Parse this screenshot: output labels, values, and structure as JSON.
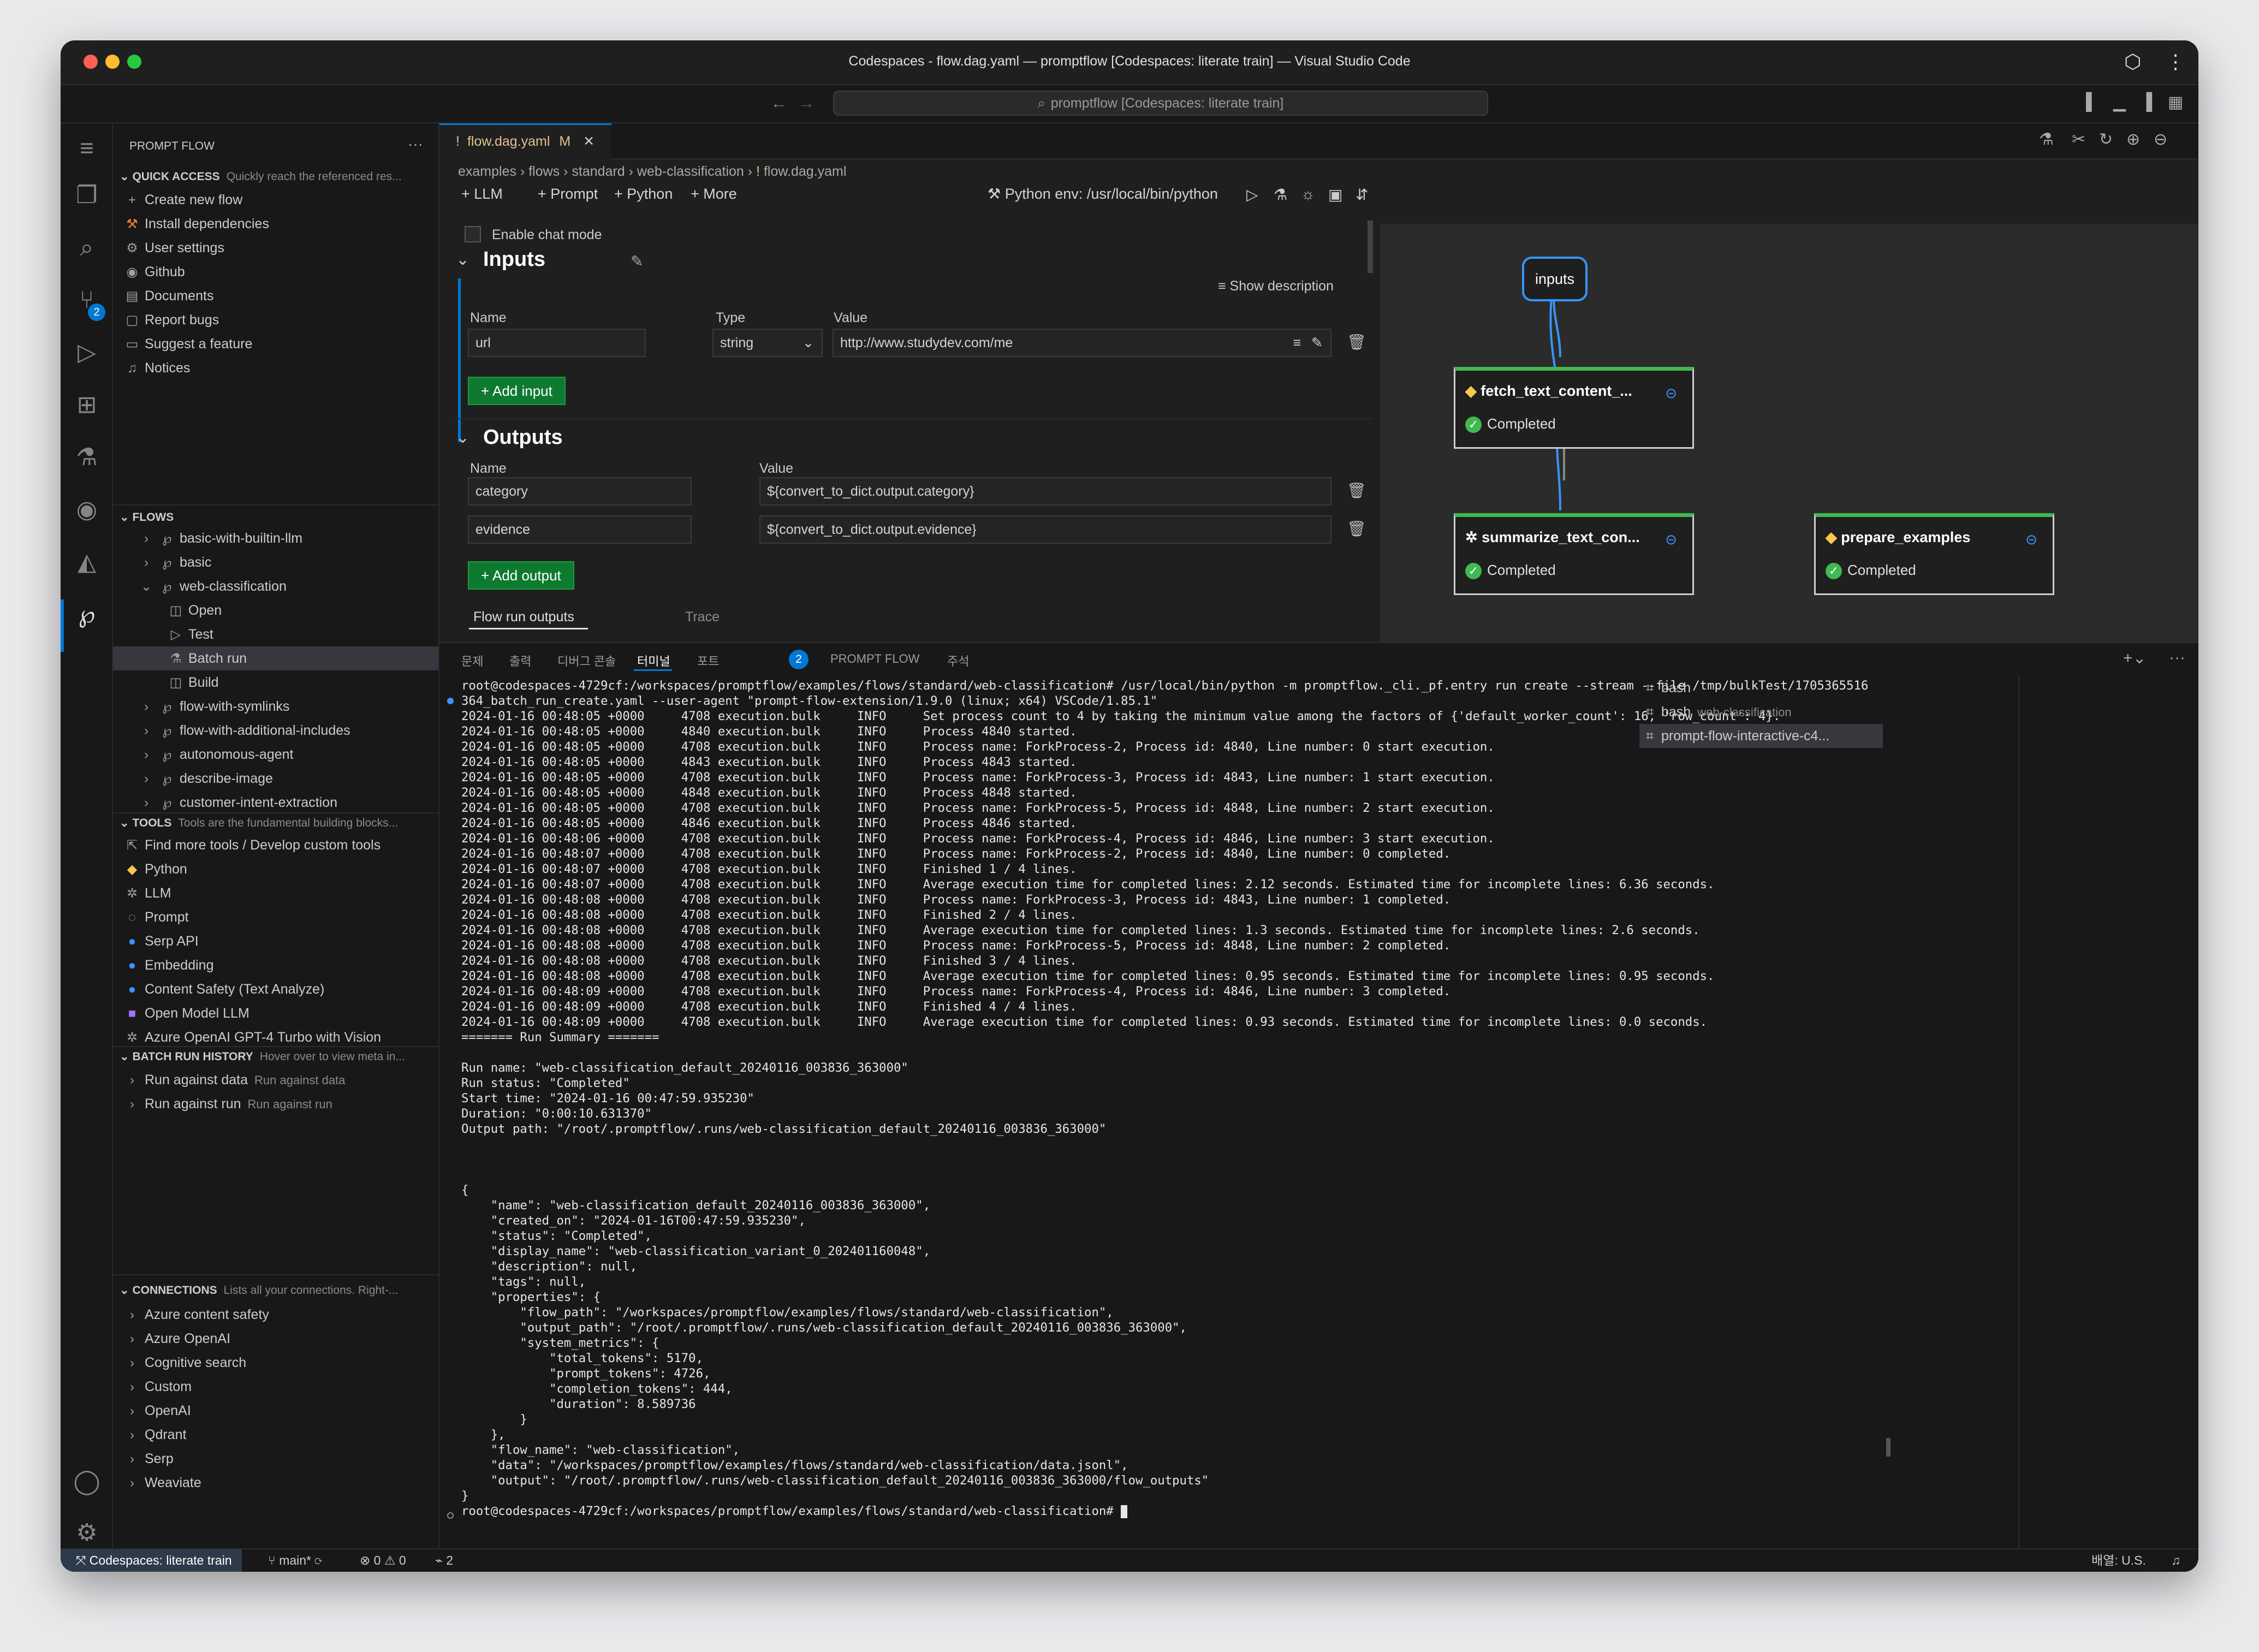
{
  "window": {
    "title": "Codespaces - flow.dag.yaml — promptflow [Codespaces: literate train] — Visual Studio Code",
    "search_label": "promptflow [Codespaces: literate train]"
  },
  "activity_bar": {
    "scm_badge": "2"
  },
  "sidebar": {
    "title": "PROMPT FLOW",
    "quick_access": {
      "title": "QUICK ACCESS",
      "desc": "Quickly reach the referenced res...",
      "items": [
        "Create new flow",
        "Install dependencies",
        "User settings",
        "Github",
        "Documents",
        "Report bugs",
        "Suggest a feature",
        "Notices"
      ]
    },
    "flows": {
      "title": "FLOWS",
      "items": [
        "basic-with-builtin-llm",
        "basic",
        "web-classification",
        "Open",
        "Test",
        "Batch run",
        "Build",
        "flow-with-symlinks",
        "flow-with-additional-includes",
        "autonomous-agent",
        "describe-image",
        "customer-intent-extraction"
      ]
    },
    "tools": {
      "title": "TOOLS",
      "desc": "Tools are the fundamental building blocks...",
      "items": [
        "Find more tools / Develop custom tools",
        "Python",
        "LLM",
        "Prompt",
        "Serp API",
        "Embedding",
        "Content Safety (Text Analyze)",
        "Open Model LLM",
        "Azure OpenAI GPT-4 Turbo with Vision"
      ]
    },
    "batch_history": {
      "title": "BATCH RUN HISTORY",
      "desc": "Hover over to view meta in...",
      "items": [
        {
          "label": "Run against data",
          "desc": "Run against data"
        },
        {
          "label": "Run against run",
          "desc": "Run against run"
        }
      ]
    },
    "connections": {
      "title": "CONNECTIONS",
      "desc": "Lists all your connections. Right-...",
      "items": [
        "Azure content safety",
        "Azure OpenAI",
        "Cognitive search",
        "Custom",
        "OpenAI",
        "Qdrant",
        "Serp",
        "Weaviate"
      ]
    }
  },
  "editor": {
    "tab": {
      "label": "flow.dag.yaml",
      "status": "M",
      "marker": "!"
    },
    "breadcrumb": [
      "examples",
      "flows",
      "standard",
      "web-classification",
      "flow.dag.yaml"
    ],
    "toolbar": {
      "llm": "LLM",
      "prompt": "Prompt",
      "python": "Python",
      "more": "More",
      "env": "Python env: /usr/local/bin/python"
    },
    "chat_mode": "Enable chat mode",
    "inputs": {
      "title": "Inputs",
      "show_description": "Show description",
      "col_name": "Name",
      "col_type": "Type",
      "col_value": "Value",
      "row": {
        "name": "url",
        "type": "string",
        "value": "http://www.studydev.com/me"
      },
      "add_label": "Add input"
    },
    "outputs": {
      "title": "Outputs",
      "col_name": "Name",
      "col_value": "Value",
      "rows": [
        {
          "name": "category",
          "value": "${convert_to_dict.output.category}"
        },
        {
          "name": "evidence",
          "value": "${convert_to_dict.output.evidence}"
        }
      ],
      "add_label": "Add output"
    },
    "bottom_tabs": [
      "Flow run outputs",
      "Trace"
    ]
  },
  "dag": {
    "inputs_label": "inputs",
    "nodes": [
      {
        "title": "fetch_text_content_...",
        "status": "Completed"
      },
      {
        "title": "summarize_text_con...",
        "status": "Completed"
      },
      {
        "title": "prepare_examples",
        "status": "Completed"
      }
    ]
  },
  "panel": {
    "tabs": [
      "문제",
      "출력",
      "디버그 콘솔",
      "터미널",
      "포트",
      "PROMPT FLOW",
      "주석"
    ],
    "ports_badge": "2",
    "terminal_lines": [
      "root@codespaces-4729cf:/workspaces/promptflow/examples/flows/standard/web-classification# /usr/local/bin/python -m promptflow._cli._pf.entry run create --stream --file /tmp/bulkTest/1705365516",
      "364_batch_run_create.yaml --user-agent \"prompt-flow-extension/1.9.0 (linux; x64) VSCode/1.85.1\"",
      "2024-01-16 00:48:05 +0000     4708 execution.bulk     INFO     Set process count to 4 by taking the minimum value among the factors of {'default_worker_count': 16, 'row_count': 4}.",
      "2024-01-16 00:48:05 +0000     4840 execution.bulk     INFO     Process 4840 started.",
      "2024-01-16 00:48:05 +0000     4708 execution.bulk     INFO     Process name: ForkProcess-2, Process id: 4840, Line number: 0 start execution.",
      "2024-01-16 00:48:05 +0000     4843 execution.bulk     INFO     Process 4843 started.",
      "2024-01-16 00:48:05 +0000     4708 execution.bulk     INFO     Process name: ForkProcess-3, Process id: 4843, Line number: 1 start execution.",
      "2024-01-16 00:48:05 +0000     4848 execution.bulk     INFO     Process 4848 started.",
      "2024-01-16 00:48:05 +0000     4708 execution.bulk     INFO     Process name: ForkProcess-5, Process id: 4848, Line number: 2 start execution.",
      "2024-01-16 00:48:05 +0000     4846 execution.bulk     INFO     Process 4846 started.",
      "2024-01-16 00:48:06 +0000     4708 execution.bulk     INFO     Process name: ForkProcess-4, Process id: 4846, Line number: 3 start execution.",
      "2024-01-16 00:48:07 +0000     4708 execution.bulk     INFO     Process name: ForkProcess-2, Process id: 4840, Line number: 0 completed.",
      "2024-01-16 00:48:07 +0000     4708 execution.bulk     INFO     Finished 1 / 4 lines.",
      "2024-01-16 00:48:07 +0000     4708 execution.bulk     INFO     Average execution time for completed lines: 2.12 seconds. Estimated time for incomplete lines: 6.36 seconds.",
      "2024-01-16 00:48:08 +0000     4708 execution.bulk     INFO     Process name: ForkProcess-3, Process id: 4843, Line number: 1 completed.",
      "2024-01-16 00:48:08 +0000     4708 execution.bulk     INFO     Finished 2 / 4 lines.",
      "2024-01-16 00:48:08 +0000     4708 execution.bulk     INFO     Average execution time for completed lines: 1.3 seconds. Estimated time for incomplete lines: 2.6 seconds.",
      "2024-01-16 00:48:08 +0000     4708 execution.bulk     INFO     Process name: ForkProcess-5, Process id: 4848, Line number: 2 completed.",
      "2024-01-16 00:48:08 +0000     4708 execution.bulk     INFO     Finished 3 / 4 lines.",
      "2024-01-16 00:48:08 +0000     4708 execution.bulk     INFO     Average execution time for completed lines: 0.95 seconds. Estimated time for incomplete lines: 0.95 seconds.",
      "2024-01-16 00:48:09 +0000     4708 execution.bulk     INFO     Process name: ForkProcess-4, Process id: 4846, Line number: 3 completed.",
      "2024-01-16 00:48:09 +0000     4708 execution.bulk     INFO     Finished 4 / 4 lines.",
      "2024-01-16 00:48:09 +0000     4708 execution.bulk     INFO     Average execution time for completed lines: 0.93 seconds. Estimated time for incomplete lines: 0.0 seconds.",
      "======= Run Summary =======",
      "",
      "Run name: \"web-classification_default_20240116_003836_363000\"",
      "Run status: \"Completed\"",
      "Start time: \"2024-01-16 00:47:59.935230\"",
      "Duration: \"0:00:10.631370\"",
      "Output path: \"/root/.promptflow/.runs/web-classification_default_20240116_003836_363000\"",
      "",
      "",
      "",
      "{",
      "    \"name\": \"web-classification_default_20240116_003836_363000\",",
      "    \"created_on\": \"2024-01-16T00:47:59.935230\",",
      "    \"status\": \"Completed\",",
      "    \"display_name\": \"web-classification_variant_0_202401160048\",",
      "    \"description\": null,",
      "    \"tags\": null,",
      "    \"properties\": {",
      "        \"flow_path\": \"/workspaces/promptflow/examples/flows/standard/web-classification\",",
      "        \"output_path\": \"/root/.promptflow/.runs/web-classification_default_20240116_003836_363000\",",
      "        \"system_metrics\": {",
      "            \"total_tokens\": 5170,",
      "            \"prompt_tokens\": 4726,",
      "            \"completion_tokens\": 444,",
      "            \"duration\": 8.589736",
      "        }",
      "    },",
      "    \"flow_name\": \"web-classification\",",
      "    \"data\": \"/workspaces/promptflow/examples/flows/standard/web-classification/data.jsonl\",",
      "    \"output\": \"/root/.promptflow/.runs/web-classification_default_20240116_003836_363000/flow_outputs\"",
      "}",
      "root@codespaces-4729cf:/workspaces/promptflow/examples/flows/standard/web-classification# "
    ],
    "terminal_list": [
      {
        "label": "bash",
        "desc": ""
      },
      {
        "label": "bash",
        "desc": "web-classification"
      },
      {
        "label": "prompt-flow-interactive-c4...",
        "desc": ""
      }
    ]
  },
  "statusbar": {
    "remote": "Codespaces: literate train",
    "branch": "main*",
    "errors": "0",
    "warnings": "0",
    "ports": "2",
    "layout": "배열: U.S."
  }
}
